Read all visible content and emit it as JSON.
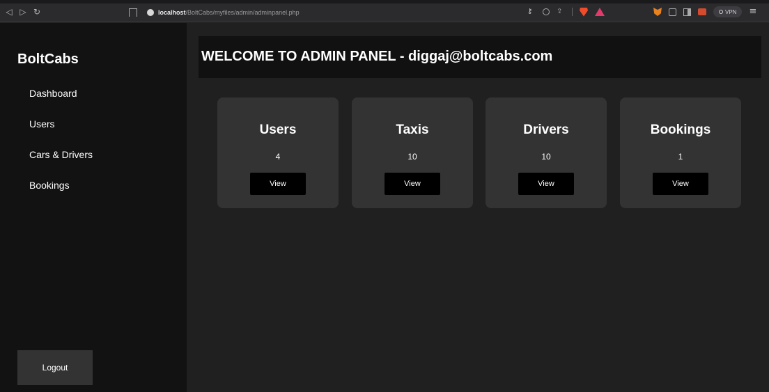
{
  "browser": {
    "url_host": "localhost",
    "url_path": "/BoltCabs/myfiles/admin/adminpanel.php",
    "vpn_label": "VPN",
    "icons": [
      "back-icon",
      "forward-icon",
      "reload-icon",
      "bookmark-icon",
      "site-info-icon",
      "key-icon",
      "zoom-icon",
      "share-icon",
      "brave-shields-icon",
      "brave-rewards-icon",
      "metamask-icon",
      "extensions-icon",
      "sidebar-toggle-icon",
      "wallet-icon",
      "vpn-icon",
      "menu-icon"
    ]
  },
  "sidebar": {
    "brand": "BoltCabs",
    "items": [
      {
        "label": "Dashboard"
      },
      {
        "label": "Users"
      },
      {
        "label": "Cars & Drivers"
      },
      {
        "label": "Bookings"
      }
    ],
    "logout_label": "Logout"
  },
  "header": {
    "title": "WELCOME TO ADMIN PANEL - diggaj@boltcabs.com"
  },
  "cards": [
    {
      "title": "Users",
      "count": "4",
      "button": "View"
    },
    {
      "title": "Taxis",
      "count": "10",
      "button": "View"
    },
    {
      "title": "Drivers",
      "count": "10",
      "button": "View"
    },
    {
      "title": "Bookings",
      "count": "1",
      "button": "View"
    }
  ],
  "colors": {
    "page_bg": "#202020",
    "sidebar_bg": "#121212",
    "header_bg": "#111111",
    "card_bg": "#333333",
    "button_bg": "#000000",
    "text": "#ffffff"
  }
}
